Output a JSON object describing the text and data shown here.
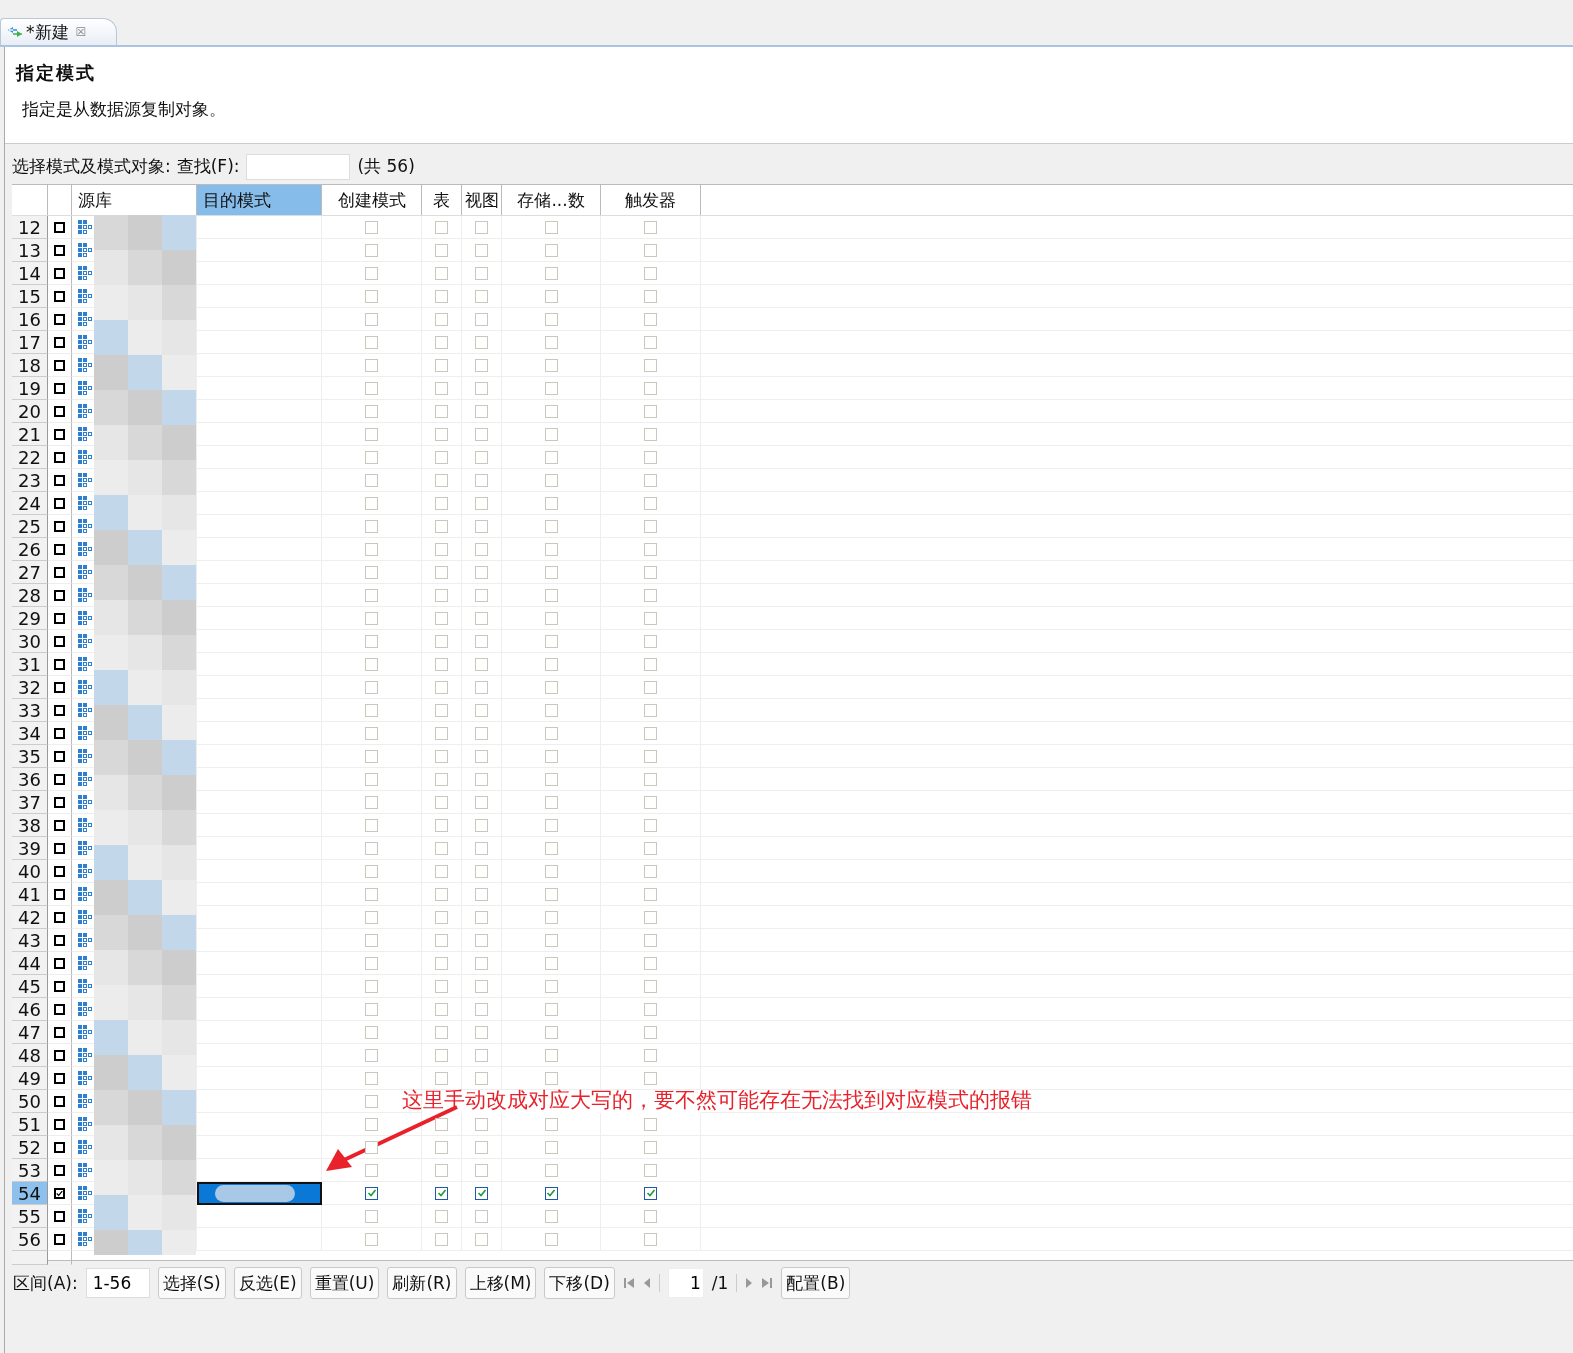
{
  "tab": {
    "title": "*新建",
    "close": "☒"
  },
  "header": {
    "title": "指定模式",
    "description": "指定是从数据源复制对象。"
  },
  "filter": {
    "label": "选择模式及模式对象:",
    "find_label": "查找(F):",
    "count": "(共 56)"
  },
  "table": {
    "columns": [
      {
        "label": "源库",
        "sorted": false
      },
      {
        "label": "目的模式",
        "sorted": true
      },
      {
        "label": "创建模式",
        "sorted": false
      },
      {
        "label": "表",
        "sorted": false
      },
      {
        "label": "视图",
        "sorted": false
      },
      {
        "label": "存储...数",
        "sorted": false
      },
      {
        "label": "触发器",
        "sorted": false
      }
    ],
    "rows": [
      {
        "number": "12",
        "checked": false,
        "create_schema": false,
        "table": false,
        "view": false,
        "procedure": false,
        "trigger": false,
        "selected": false
      },
      {
        "number": "13",
        "checked": false,
        "create_schema": false,
        "table": false,
        "view": false,
        "procedure": false,
        "trigger": false,
        "selected": false
      },
      {
        "number": "14",
        "checked": false,
        "create_schema": false,
        "table": false,
        "view": false,
        "procedure": false,
        "trigger": false,
        "selected": false
      },
      {
        "number": "15",
        "checked": false,
        "create_schema": false,
        "table": false,
        "view": false,
        "procedure": false,
        "trigger": false,
        "selected": false
      },
      {
        "number": "16",
        "checked": false,
        "create_schema": false,
        "table": false,
        "view": false,
        "procedure": false,
        "trigger": false,
        "selected": false
      },
      {
        "number": "17",
        "checked": false,
        "create_schema": false,
        "table": false,
        "view": false,
        "procedure": false,
        "trigger": false,
        "selected": false
      },
      {
        "number": "18",
        "checked": false,
        "create_schema": false,
        "table": false,
        "view": false,
        "procedure": false,
        "trigger": false,
        "selected": false
      },
      {
        "number": "19",
        "checked": false,
        "create_schema": false,
        "table": false,
        "view": false,
        "procedure": false,
        "trigger": false,
        "selected": false
      },
      {
        "number": "20",
        "checked": false,
        "create_schema": false,
        "table": false,
        "view": false,
        "procedure": false,
        "trigger": false,
        "selected": false
      },
      {
        "number": "21",
        "checked": false,
        "create_schema": false,
        "table": false,
        "view": false,
        "procedure": false,
        "trigger": false,
        "selected": false
      },
      {
        "number": "22",
        "checked": false,
        "create_schema": false,
        "table": false,
        "view": false,
        "procedure": false,
        "trigger": false,
        "selected": false
      },
      {
        "number": "23",
        "checked": false,
        "create_schema": false,
        "table": false,
        "view": false,
        "procedure": false,
        "trigger": false,
        "selected": false
      },
      {
        "number": "24",
        "checked": false,
        "create_schema": false,
        "table": false,
        "view": false,
        "procedure": false,
        "trigger": false,
        "selected": false
      },
      {
        "number": "25",
        "checked": false,
        "create_schema": false,
        "table": false,
        "view": false,
        "procedure": false,
        "trigger": false,
        "selected": false
      },
      {
        "number": "26",
        "checked": false,
        "create_schema": false,
        "table": false,
        "view": false,
        "procedure": false,
        "trigger": false,
        "selected": false
      },
      {
        "number": "27",
        "checked": false,
        "create_schema": false,
        "table": false,
        "view": false,
        "procedure": false,
        "trigger": false,
        "selected": false
      },
      {
        "number": "28",
        "checked": false,
        "create_schema": false,
        "table": false,
        "view": false,
        "procedure": false,
        "trigger": false,
        "selected": false
      },
      {
        "number": "29",
        "checked": false,
        "create_schema": false,
        "table": false,
        "view": false,
        "procedure": false,
        "trigger": false,
        "selected": false
      },
      {
        "number": "30",
        "checked": false,
        "create_schema": false,
        "table": false,
        "view": false,
        "procedure": false,
        "trigger": false,
        "selected": false
      },
      {
        "number": "31",
        "checked": false,
        "create_schema": false,
        "table": false,
        "view": false,
        "procedure": false,
        "trigger": false,
        "selected": false
      },
      {
        "number": "32",
        "checked": false,
        "create_schema": false,
        "table": false,
        "view": false,
        "procedure": false,
        "trigger": false,
        "selected": false
      },
      {
        "number": "33",
        "checked": false,
        "create_schema": false,
        "table": false,
        "view": false,
        "procedure": false,
        "trigger": false,
        "selected": false
      },
      {
        "number": "34",
        "checked": false,
        "create_schema": false,
        "table": false,
        "view": false,
        "procedure": false,
        "trigger": false,
        "selected": false
      },
      {
        "number": "35",
        "checked": false,
        "create_schema": false,
        "table": false,
        "view": false,
        "procedure": false,
        "trigger": false,
        "selected": false
      },
      {
        "number": "36",
        "checked": false,
        "create_schema": false,
        "table": false,
        "view": false,
        "procedure": false,
        "trigger": false,
        "selected": false
      },
      {
        "number": "37",
        "checked": false,
        "create_schema": false,
        "table": false,
        "view": false,
        "procedure": false,
        "trigger": false,
        "selected": false
      },
      {
        "number": "38",
        "checked": false,
        "create_schema": false,
        "table": false,
        "view": false,
        "procedure": false,
        "trigger": false,
        "selected": false
      },
      {
        "number": "39",
        "checked": false,
        "create_schema": false,
        "table": false,
        "view": false,
        "procedure": false,
        "trigger": false,
        "selected": false
      },
      {
        "number": "40",
        "checked": false,
        "create_schema": false,
        "table": false,
        "view": false,
        "procedure": false,
        "trigger": false,
        "selected": false
      },
      {
        "number": "41",
        "checked": false,
        "create_schema": false,
        "table": false,
        "view": false,
        "procedure": false,
        "trigger": false,
        "selected": false
      },
      {
        "number": "42",
        "checked": false,
        "create_schema": false,
        "table": false,
        "view": false,
        "procedure": false,
        "trigger": false,
        "selected": false
      },
      {
        "number": "43",
        "checked": false,
        "create_schema": false,
        "table": false,
        "view": false,
        "procedure": false,
        "trigger": false,
        "selected": false
      },
      {
        "number": "44",
        "checked": false,
        "create_schema": false,
        "table": false,
        "view": false,
        "procedure": false,
        "trigger": false,
        "selected": false
      },
      {
        "number": "45",
        "checked": false,
        "create_schema": false,
        "table": false,
        "view": false,
        "procedure": false,
        "trigger": false,
        "selected": false
      },
      {
        "number": "46",
        "checked": false,
        "create_schema": false,
        "table": false,
        "view": false,
        "procedure": false,
        "trigger": false,
        "selected": false
      },
      {
        "number": "47",
        "checked": false,
        "create_schema": false,
        "table": false,
        "view": false,
        "procedure": false,
        "trigger": false,
        "selected": false
      },
      {
        "number": "48",
        "checked": false,
        "create_schema": false,
        "table": false,
        "view": false,
        "procedure": false,
        "trigger": false,
        "selected": false
      },
      {
        "number": "49",
        "checked": false,
        "create_schema": false,
        "table": false,
        "view": false,
        "procedure": false,
        "trigger": false,
        "selected": false
      },
      {
        "number": "50",
        "checked": false,
        "create_schema": false,
        "selected": false
      },
      {
        "number": "51",
        "checked": false,
        "create_schema": false,
        "table": false,
        "view": false,
        "procedure": false,
        "trigger": false,
        "selected": false
      },
      {
        "number": "52",
        "checked": false,
        "create_schema": false,
        "table": false,
        "view": false,
        "procedure": false,
        "trigger": false,
        "selected": false
      },
      {
        "number": "53",
        "checked": false,
        "create_schema": false,
        "table": false,
        "view": false,
        "procedure": false,
        "trigger": false,
        "selected": false
      },
      {
        "number": "54",
        "checked": true,
        "create_schema": true,
        "table": true,
        "view": true,
        "procedure": true,
        "trigger": true,
        "selected": true
      },
      {
        "number": "55",
        "checked": false,
        "create_schema": false,
        "table": false,
        "view": false,
        "procedure": false,
        "trigger": false,
        "selected": false
      },
      {
        "number": "56",
        "checked": false,
        "create_schema": false,
        "table": false,
        "view": false,
        "procedure": false,
        "trigger": false,
        "selected": false
      }
    ]
  },
  "annotation": {
    "text": "这里手动改成对应大写的，要不然可能存在无法找到对应模式的报错"
  },
  "footer": {
    "range_label": "区间(A):",
    "range_value": "1-56",
    "buttons": [
      "选择(S)",
      "反选(E)",
      "重置(U)",
      "刷新(R)",
      "上移(M)",
      "下移(D)"
    ],
    "page_value": "1",
    "page_total": "/1",
    "config_button": "配置(B)"
  }
}
